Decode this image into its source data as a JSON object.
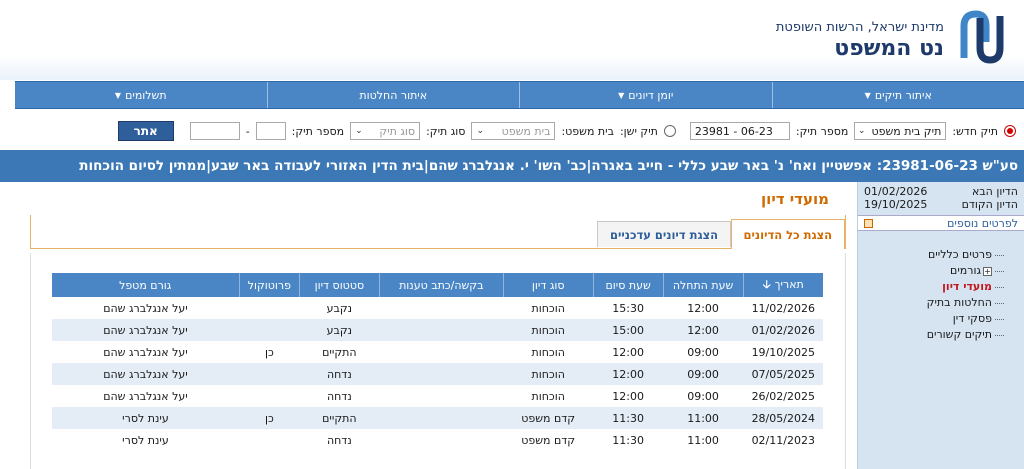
{
  "header": {
    "subtitle": "מדינת ישראל, הרשות השופטת",
    "title": "נט המשפט"
  },
  "colors": {
    "primary": "#4a86c5",
    "banner": "#3c78b6",
    "accent": "#d06a00",
    "active_tree": "#c4161c"
  },
  "nav": [
    {
      "label": "איתור תיקים",
      "has_dropdown": true
    },
    {
      "label": "יומן דיונים",
      "has_dropdown": true
    },
    {
      "label": "איתור החלטות",
      "has_dropdown": false
    },
    {
      "label": "תשלומים",
      "has_dropdown": true
    }
  ],
  "search": {
    "new_case_label": "תיק חדש:",
    "court_type_value": "תיק בית משפט",
    "case_number_label": "מספר תיק:",
    "case_number_value": "23981 - 06-23",
    "old_case_label": "תיק ישן:",
    "court_label": "בית משפט:",
    "court_placeholder": "בית משפט",
    "case_type_label": "סוג תיק:",
    "case_type_placeholder": "סוג תיק",
    "case_number2_label": "מספר תיק:",
    "case_number2_sep": "-",
    "go_button": "אתר"
  },
  "banner": {
    "text": "סע\"ש 23981-06-23: אפשטיין ואח' נ' באר שבע כללי - חייב באגרה|כב' השו' י. אנגלברג שהם|בית הדין האזורי לעבודה באר שבע|ממתין לסיום הוכחות"
  },
  "side": {
    "next_hearing_label": "הדיון הבא",
    "next_hearing_date": "01/02/2026",
    "prev_hearing_label": "הדיון הקודם",
    "prev_hearing_date": "19/10/2025",
    "more_details": "לפרטים נוספים",
    "tree": [
      {
        "label": "פרטים כלליים",
        "active": false,
        "expandable": false
      },
      {
        "label": "גורמים",
        "active": false,
        "expandable": true
      },
      {
        "label": "מועדי דיון",
        "active": true,
        "expandable": false
      },
      {
        "label": "החלטות בתיק",
        "active": false,
        "expandable": false
      },
      {
        "label": "פסקי דין",
        "active": false,
        "expandable": false
      },
      {
        "label": "תיקים קשורים",
        "active": false,
        "expandable": false
      }
    ]
  },
  "main": {
    "section_title": "מועדי דיון",
    "tabs": [
      {
        "label": "הצגת כל הדיונים",
        "active": true
      },
      {
        "label": "הצגת דיונים עדכניים",
        "active": false
      }
    ],
    "table": {
      "columns": [
        "תאריך",
        "שעת התחלה",
        "שעת סיום",
        "סוג דיון",
        "בקשה/כתב טענות",
        "סטטוס דיון",
        "פרוטוקול",
        "גורם מטפל"
      ],
      "rows": [
        [
          "11/02/2026",
          "12:00",
          "15:30",
          "הוכחות",
          "",
          "נקבע",
          "",
          "יעל אנגלברג שהם"
        ],
        [
          "01/02/2026",
          "12:00",
          "15:00",
          "הוכחות",
          "",
          "נקבע",
          "",
          "יעל אנגלברג שהם"
        ],
        [
          "19/10/2025",
          "09:00",
          "12:00",
          "הוכחות",
          "",
          "התקיים",
          "כן",
          "יעל אנגלברג שהם"
        ],
        [
          "07/05/2025",
          "09:00",
          "12:00",
          "הוכחות",
          "",
          "נדחה",
          "",
          "יעל אנגלברג שהם"
        ],
        [
          "26/02/2025",
          "09:00",
          "12:00",
          "הוכחות",
          "",
          "נדחה",
          "",
          "יעל אנגלברג שהם"
        ],
        [
          "28/05/2024",
          "11:00",
          "11:30",
          "קדם משפט",
          "",
          "התקיים",
          "כן",
          "עינת לסרי"
        ],
        [
          "02/11/2023",
          "11:00",
          "11:30",
          "קדם משפט",
          "",
          "נדחה",
          "",
          "עינת לסרי"
        ]
      ]
    }
  }
}
